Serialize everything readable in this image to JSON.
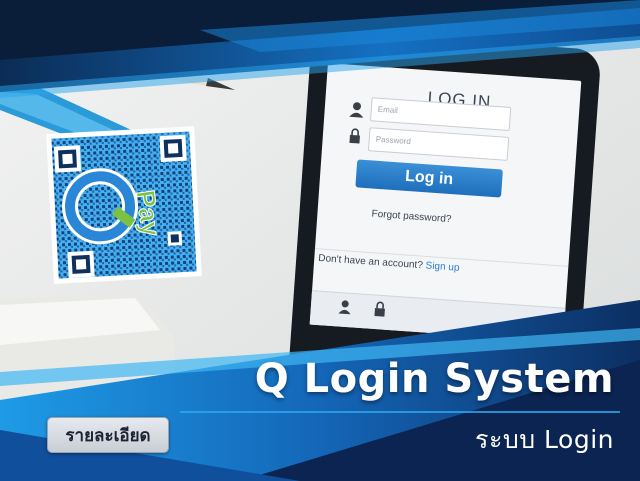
{
  "banner": {
    "title": "Q Login System",
    "subtitle": "ระบบ Login",
    "detail_button": "รายละเอียด"
  },
  "phone_screen": {
    "heading": "LOG IN",
    "email_placeholder": "Email",
    "password_placeholder": "Password",
    "login_button": "Log in",
    "forgot_password": "Forgot password?",
    "no_account": "Don't have an account?",
    "sign_up": "Sign up"
  },
  "qr_logo": {
    "letter": "Q",
    "word": "Pay"
  },
  "colors": {
    "accent_blue": "#1f8fe0",
    "dark_navy": "#0a1e3a",
    "qr_blue": "#3aa8ea",
    "qr_green": "#7bc143"
  }
}
